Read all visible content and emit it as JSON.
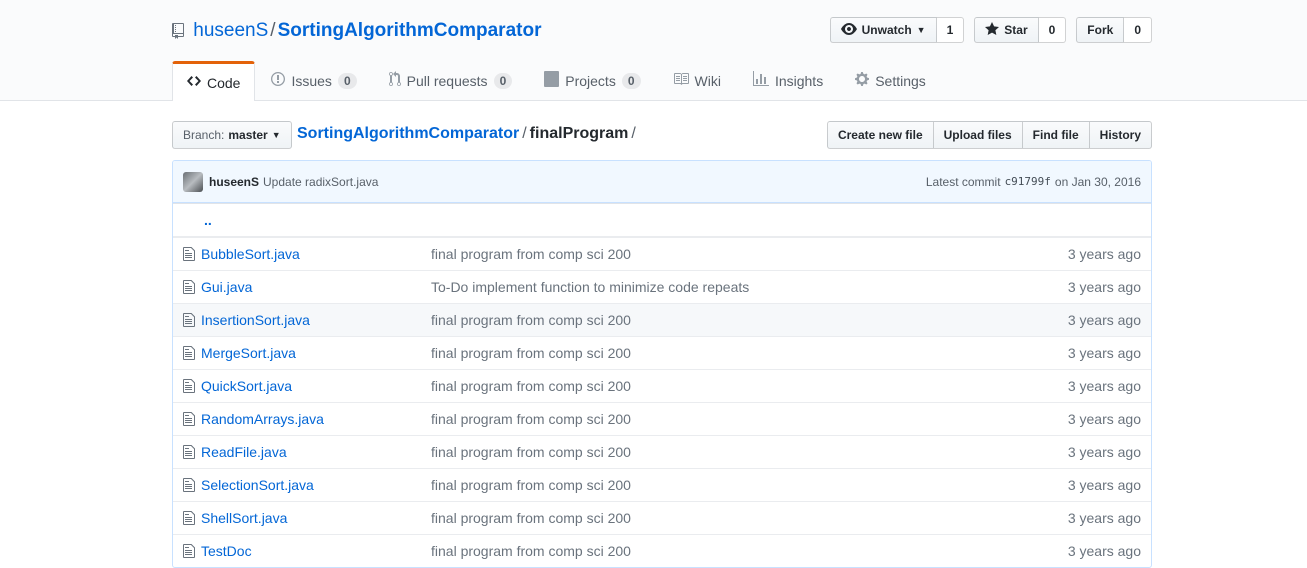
{
  "repo": {
    "owner": "huseenS",
    "separator": "/",
    "name": "SortingAlgorithmComparator"
  },
  "actions": {
    "watch_label": "Unwatch",
    "watch_count": "1",
    "star_label": "Star",
    "star_count": "0",
    "fork_label": "Fork",
    "fork_count": "0"
  },
  "tabs": [
    {
      "label": "Code"
    },
    {
      "label": "Issues",
      "badge": "0"
    },
    {
      "label": "Pull requests",
      "badge": "0"
    },
    {
      "label": "Projects",
      "badge": "0"
    },
    {
      "label": "Wiki"
    },
    {
      "label": "Insights"
    },
    {
      "label": "Settings"
    }
  ],
  "branch": {
    "label": "Branch:",
    "value": "master"
  },
  "breadcrumb": {
    "root": "SortingAlgorithmComparator",
    "sep": "/",
    "current": "finalProgram",
    "trailing": "/"
  },
  "file_buttons": {
    "create": "Create new file",
    "upload": "Upload files",
    "find": "Find file",
    "history": "History"
  },
  "commit": {
    "author": "huseenS",
    "message": "Update radixSort.java",
    "latest_label": "Latest commit",
    "sha": "c91799f",
    "date": "on Jan 30, 2016"
  },
  "up_dir": "..",
  "files": [
    {
      "name": "BubbleSort.java",
      "message": "final program from comp sci 200",
      "age": "3 years ago"
    },
    {
      "name": "Gui.java",
      "message": "To-Do implement function to minimize code repeats",
      "age": "3 years ago"
    },
    {
      "name": "InsertionSort.java",
      "message": "final program from comp sci 200",
      "age": "3 years ago"
    },
    {
      "name": "MergeSort.java",
      "message": "final program from comp sci 200",
      "age": "3 years ago"
    },
    {
      "name": "QuickSort.java",
      "message": "final program from comp sci 200",
      "age": "3 years ago"
    },
    {
      "name": "RandomArrays.java",
      "message": "final program from comp sci 200",
      "age": "3 years ago"
    },
    {
      "name": "ReadFile.java",
      "message": "final program from comp sci 200",
      "age": "3 years ago"
    },
    {
      "name": "SelectionSort.java",
      "message": "final program from comp sci 200",
      "age": "3 years ago"
    },
    {
      "name": "ShellSort.java",
      "message": "final program from comp sci 200",
      "age": "3 years ago"
    },
    {
      "name": "TestDoc",
      "message": "final program from comp sci 200",
      "age": "3 years ago"
    }
  ]
}
